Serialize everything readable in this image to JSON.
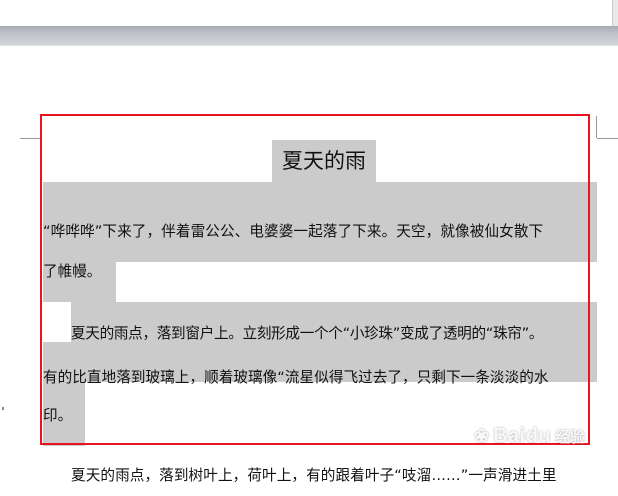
{
  "document": {
    "title": "夏天的雨",
    "lines": [
      "“哗哗哗”下来了，伴着雷公公、电婆婆一起落了下来。天空，就像被仙女散下",
      "了帷幔。",
      "夏天的雨点，落到窗户上。立刻形成一个个“小珍珠”变成了透明的“珠帘”。",
      "有的比直地落到玻璃上，顺着玻璃像“流星似得飞过去了，只剩下一条淡淡的水",
      "印。",
      "夏天的雨点，落到树叶上，荷叶上，有的跟着叶子“吱溜……”一声滑进土里"
    ]
  },
  "watermark": {
    "brand": "Baidu",
    "suffix": "经验"
  },
  "colors": {
    "selection": "#cbcbcb",
    "highlight_border": "#e8141f",
    "ruler": "#c0c3c9"
  }
}
